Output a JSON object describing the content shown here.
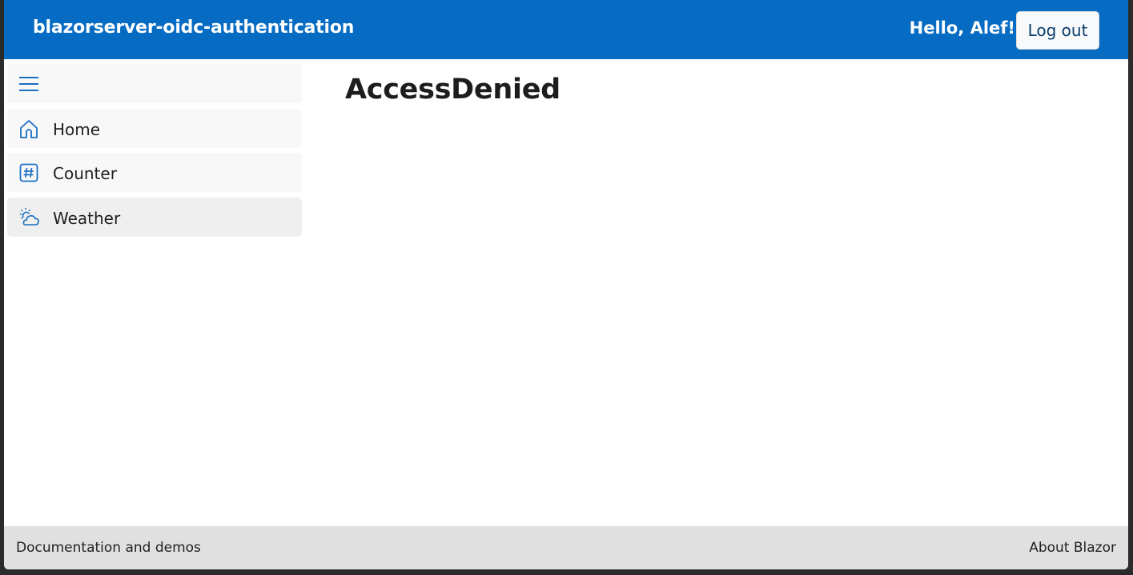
{
  "header": {
    "app_title": "blazorserver-oidc-authentication",
    "greeting": "Hello, Alef!",
    "logout_label": "Log out"
  },
  "sidebar": {
    "toggle_icon": "hamburger-menu-icon",
    "items": [
      {
        "label": "Home",
        "icon": "house-icon",
        "active": false
      },
      {
        "label": "Counter",
        "icon": "hash-square-icon",
        "active": false
      },
      {
        "label": "Weather",
        "icon": "cloud-sun-icon",
        "active": true
      }
    ]
  },
  "main": {
    "heading": "AccessDenied"
  },
  "footer": {
    "left_link": "Documentation and demos",
    "right_link": "About Blazor"
  },
  "colors": {
    "header_bg": "#056bc3",
    "icon_blue": "#1a6fc4",
    "footer_bg": "#e0e0e0"
  }
}
